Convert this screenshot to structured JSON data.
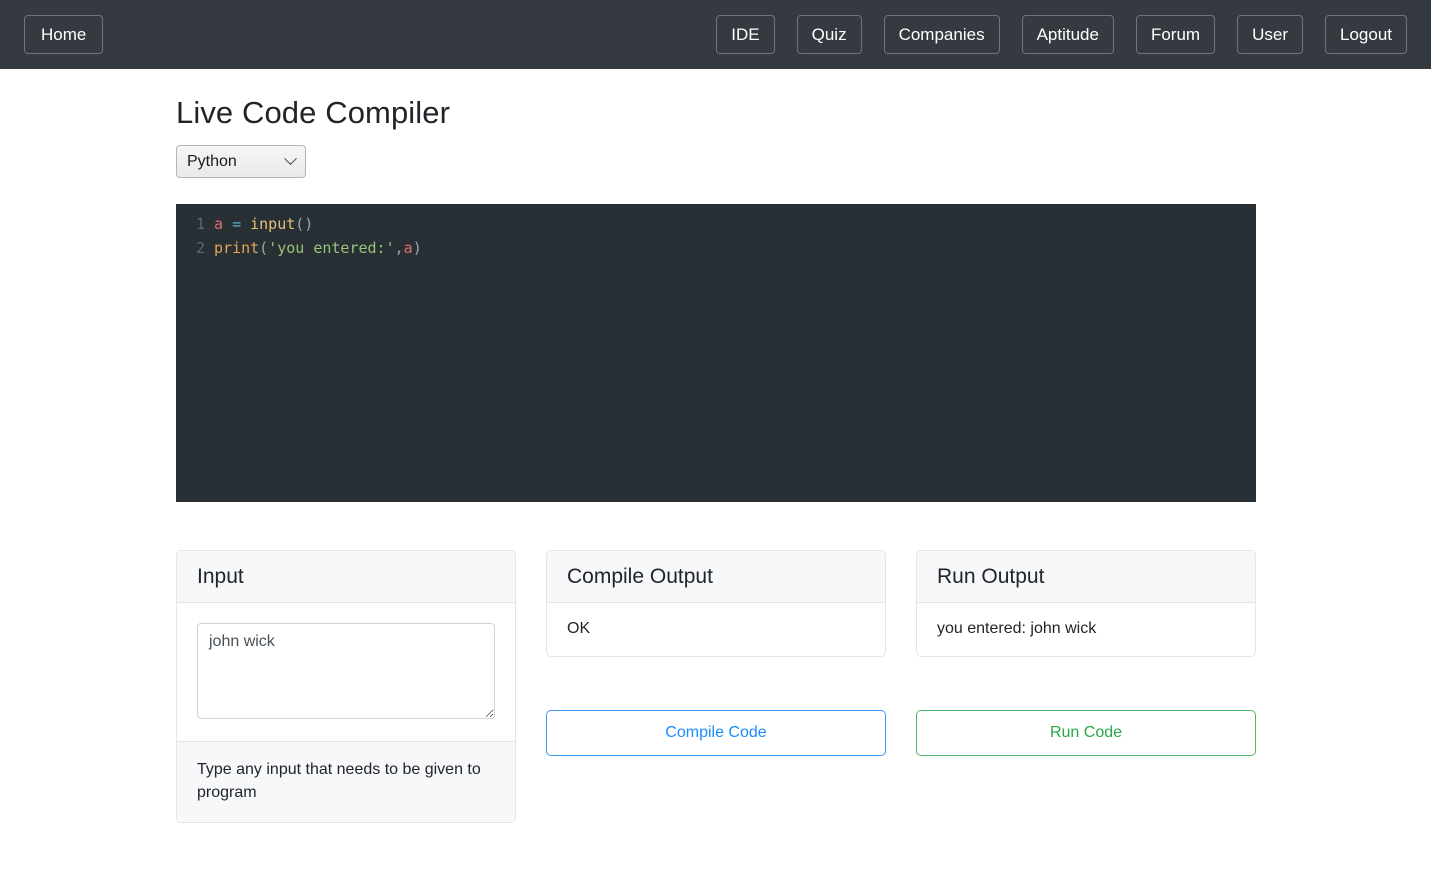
{
  "navbar": {
    "home_label": "Home",
    "links": [
      {
        "label": "IDE"
      },
      {
        "label": "Quiz"
      },
      {
        "label": "Companies"
      },
      {
        "label": "Aptitude"
      },
      {
        "label": "Forum"
      },
      {
        "label": "User"
      },
      {
        "label": "Logout"
      }
    ]
  },
  "page": {
    "title": "Live Code Compiler"
  },
  "language_select": {
    "selected": "Python",
    "icon": "chevron-down-icon"
  },
  "editor": {
    "lines": [
      {
        "number": "1",
        "tokens": [
          {
            "text": "a",
            "type": "var"
          },
          {
            "text": " ",
            "type": "punct"
          },
          {
            "text": "=",
            "type": "op"
          },
          {
            "text": " ",
            "type": "punct"
          },
          {
            "text": "input",
            "type": "fn"
          },
          {
            "text": "()",
            "type": "punct"
          }
        ]
      },
      {
        "number": "2",
        "tokens": [
          {
            "text": "print",
            "type": "kw"
          },
          {
            "text": "(",
            "type": "punct"
          },
          {
            "text": "'you entered:'",
            "type": "str"
          },
          {
            "text": ",",
            "type": "punct"
          },
          {
            "text": "a",
            "type": "var"
          },
          {
            "text": ")",
            "type": "punct"
          }
        ]
      }
    ],
    "line1": {
      "num": "1",
      "var": "a",
      "op": "=",
      "fn": "input",
      "parens": "()"
    },
    "line2": {
      "num": "2",
      "fn": "print",
      "open": "(",
      "str": "'you entered:'",
      "comma": ",",
      "var": "a",
      "close": ")"
    }
  },
  "input_card": {
    "header": "Input",
    "value": "john wick",
    "placeholder": "",
    "footer": "Type any input that needs to be given to program"
  },
  "compile_card": {
    "header": "Compile Output",
    "output": "OK",
    "button_label": "Compile Code"
  },
  "run_card": {
    "header": "Run Output",
    "output": "you entered: john wick",
    "button_label": "Run Code"
  },
  "colors": {
    "navbar_bg": "#343a40",
    "editor_bg": "#282f35",
    "compile_accent": "#1a8cff",
    "run_accent": "#28a745",
    "card_header_bg": "#f7f8f9"
  }
}
